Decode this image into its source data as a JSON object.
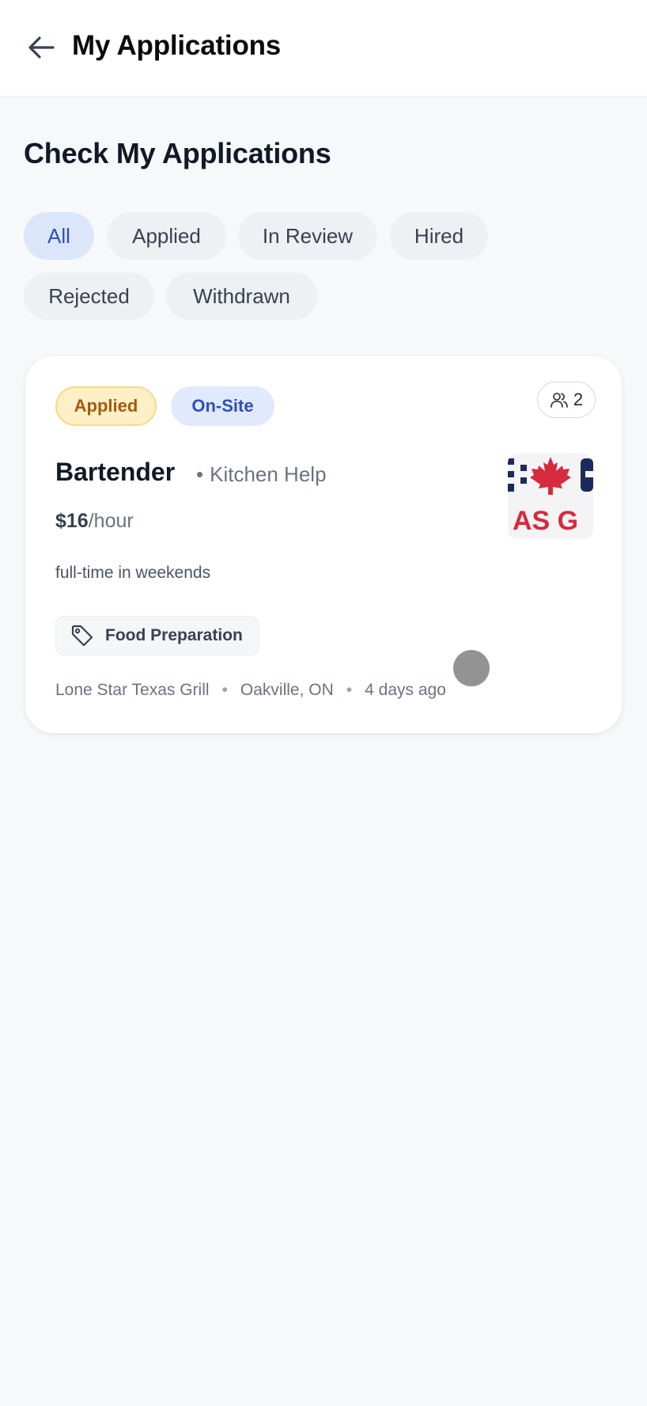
{
  "header": {
    "title": "My Applications",
    "back_icon": "arrow-left-icon"
  },
  "section": {
    "title": "Check My Applications"
  },
  "filters": {
    "selected": "All",
    "items": [
      {
        "label": "All"
      },
      {
        "label": "Applied"
      },
      {
        "label": "In Review"
      },
      {
        "label": "Hired"
      },
      {
        "label": "Rejected"
      },
      {
        "label": "Withdrawn"
      }
    ]
  },
  "application": {
    "status_badge": "Applied",
    "work_mode_badge": "On-Site",
    "applicant_count": "2",
    "applicant_icon": "users-icon",
    "title": "Bartender",
    "category_separator": "•",
    "category": "Kitchen Help",
    "pay_amount": "$16",
    "pay_unit": "/hour",
    "description": "full-time in weekends",
    "skill_icon": "tag-icon",
    "skill": "Food Preparation",
    "employer": "Lone Star Texas Grill",
    "location": "Oakville, ON",
    "posted": "4 days ago",
    "logo_text": "AS G",
    "logo_icon": "maple-leaf-icon"
  },
  "colors": {
    "active_chip_bg": "#dbe6fb",
    "active_chip_text": "#2f4fb5",
    "applied_badge_bg": "#fdf0c7",
    "applied_badge_text": "#a35a0f",
    "onsite_badge_bg": "#e1e9fc",
    "logo_red": "#d52b3c",
    "logo_navy": "#1b2a5b"
  }
}
